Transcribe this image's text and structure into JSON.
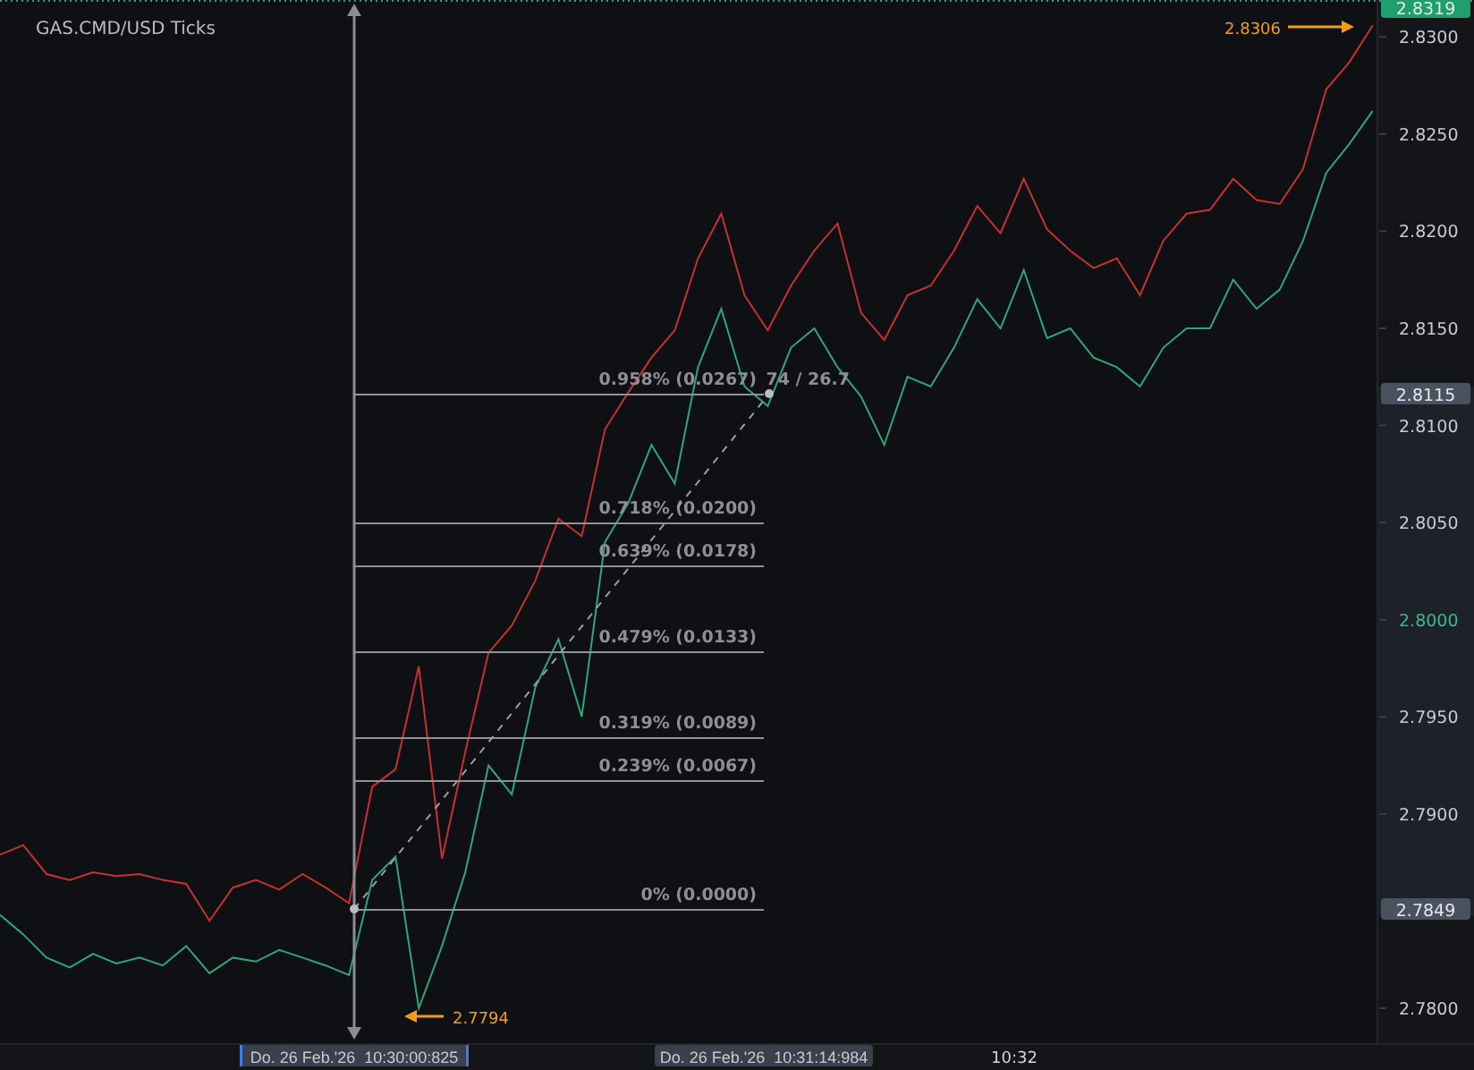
{
  "title": "GAS.CMD/USD Ticks",
  "price_tick_accents": [
    false,
    false,
    false,
    false,
    false,
    false,
    true,
    false,
    false,
    false
  ],
  "chart_data": {
    "type": "line",
    "ylim": [
      2.7782,
      2.8319
    ],
    "categories": [
      null,
      null,
      null,
      null,
      null,
      null,
      null,
      null,
      null,
      null,
      null,
      null,
      null,
      null,
      null,
      null,
      null,
      null,
      null,
      null,
      null,
      null,
      null,
      null,
      null,
      null,
      null,
      null,
      null,
      null,
      null,
      null,
      null,
      null,
      null,
      null,
      null,
      null,
      null,
      null,
      null,
      null,
      null,
      null,
      null,
      null,
      null,
      null,
      null,
      null,
      null,
      null,
      null,
      null,
      null,
      null,
      null,
      null,
      null,
      null
    ],
    "yticks": [
      {
        "value": 2.83,
        "label": "2.8300"
      },
      {
        "value": 2.825,
        "label": "2.8250"
      },
      {
        "value": 2.82,
        "label": "2.8200"
      },
      {
        "value": 2.815,
        "label": "2.8150"
      },
      {
        "value": 2.81,
        "label": "2.8100"
      },
      {
        "value": 2.805,
        "label": "2.8050"
      },
      {
        "value": 2.8,
        "label": "2.8000"
      },
      {
        "value": 2.795,
        "label": "2.7950"
      },
      {
        "value": 2.79,
        "label": "2.7900"
      },
      {
        "value": 2.78,
        "label": "2.7800"
      }
    ],
    "series": [
      {
        "color": "#c6312d",
        "values": [
          2.7879,
          2.7884,
          2.7869,
          2.7866,
          2.787,
          2.7868,
          2.7869,
          2.7866,
          2.7864,
          2.7845,
          2.7862,
          2.7866,
          2.7861,
          2.7869,
          2.7862,
          2.7854,
          2.7914,
          2.7923,
          2.7976,
          2.7877,
          2.7932,
          2.7983,
          2.7997,
          2.802,
          2.8052,
          2.8043,
          2.8098,
          2.8117,
          2.8135,
          2.8149,
          2.8186,
          2.8209,
          2.8167,
          2.8149,
          2.8172,
          2.819,
          2.8204,
          2.8158,
          2.8144,
          2.8167,
          2.8172,
          2.819,
          2.8213,
          2.8199,
          2.8227,
          2.8201,
          2.819,
          2.8181,
          2.8186,
          2.8167,
          2.8195,
          2.8209,
          2.8211,
          2.8227,
          2.8216,
          2.8214,
          2.8232,
          2.8273,
          2.8287,
          2.8306
        ]
      },
      {
        "color": "#2fa57a",
        "values": [
          2.7848,
          2.7838,
          2.7826,
          2.7821,
          2.7828,
          2.7823,
          2.7826,
          2.7822,
          2.7832,
          2.7818,
          2.7826,
          2.7824,
          2.783,
          2.7826,
          2.7822,
          2.7817,
          2.7866,
          2.7878,
          2.78,
          2.7832,
          2.787,
          2.7925,
          2.791,
          2.7965,
          2.799,
          2.795,
          2.804,
          2.806,
          2.809,
          2.807,
          2.813,
          2.816,
          2.812,
          2.811,
          2.814,
          2.815,
          2.813,
          2.8115,
          2.809,
          2.8125,
          2.812,
          2.814,
          2.8165,
          2.815,
          2.818,
          2.8145,
          2.815,
          2.8135,
          2.813,
          2.812,
          2.814,
          2.815,
          2.815,
          2.8175,
          2.816,
          2.817,
          2.8195,
          2.823,
          2.8245,
          2.8262
        ]
      }
    ]
  },
  "price_badges": [
    {
      "label": "2.8319",
      "kind": "current"
    },
    {
      "label": "2.8115",
      "kind": "measure"
    },
    {
      "label": "2.7849",
      "kind": "measure"
    }
  ],
  "price_markers": [
    {
      "label": "2.8306",
      "kind": "high"
    },
    {
      "label": "2.7794",
      "kind": "low"
    }
  ],
  "fib_levels": [
    "0.958% (0.0267)",
    "0.718% (0.0200)",
    "0.639% (0.0178)",
    "0.479% (0.0133)",
    "0.319% (0.0089)",
    "0.239% (0.0067)",
    "0% (0.0000)"
  ],
  "measure_label": "74 / 26.7",
  "time_badges": [
    {
      "label": "Do. 26 Feb.'26  10:30:00:825",
      "selected": true
    },
    {
      "label": "Do. 26 Feb.'26  10:31:14:984",
      "selected": false
    }
  ],
  "time_ticks": [
    "10:32"
  ]
}
